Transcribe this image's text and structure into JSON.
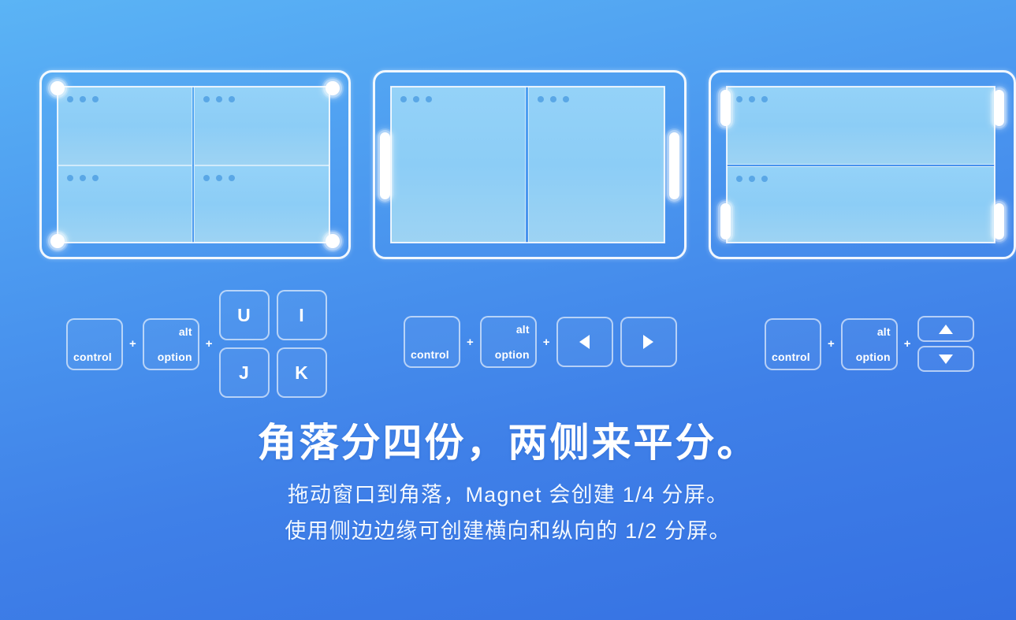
{
  "background": {
    "gradient_from": "#5bb4f5",
    "gradient_to": "#3570e2"
  },
  "panels": [
    {
      "name": "quarter-corners",
      "layout": "2x2",
      "handles": "four-corner-circles",
      "windows": [
        {
          "dots": 3
        },
        {
          "dots": 3
        },
        {
          "dots": 3
        },
        {
          "dots": 3
        }
      ]
    },
    {
      "name": "vertical-halves",
      "layout": "1x2-vertical",
      "handles": "left-right-edge-pills",
      "windows": [
        {
          "dots": 3
        },
        {
          "dots": 3
        }
      ]
    },
    {
      "name": "horizontal-halves",
      "layout": "2x1-horizontal",
      "handles": "four-side-pills",
      "windows": [
        {
          "dots": 3
        },
        {
          "dots": 3
        }
      ]
    }
  ],
  "shortcuts": [
    {
      "id": "corner-quarters",
      "modifiers": [
        {
          "top": "",
          "bottom": "control",
          "align": "left"
        },
        {
          "top": "alt",
          "bottom": "option",
          "align": "right"
        }
      ],
      "plus": "+",
      "keys": [
        "U",
        "I",
        "J",
        "K"
      ]
    },
    {
      "id": "left-right-halves",
      "modifiers": [
        {
          "top": "",
          "bottom": "control",
          "align": "left"
        },
        {
          "top": "alt",
          "bottom": "option",
          "align": "right"
        }
      ],
      "plus": "+",
      "keys": [
        "arrow-left",
        "arrow-right"
      ]
    },
    {
      "id": "top-bottom-halves",
      "modifiers": [
        {
          "top": "",
          "bottom": "control",
          "align": "left"
        },
        {
          "top": "alt",
          "bottom": "option",
          "align": "right"
        }
      ],
      "plus": "+",
      "keys": [
        "arrow-up",
        "arrow-down"
      ]
    }
  ],
  "caption": {
    "headline": "角落分四份，两侧来平分。",
    "subline_1": "拖动窗口到角落，Magnet 会创建 1/4 分屏。",
    "subline_2": "使用侧边边缘可创建横向和纵向的 1/2 分屏。"
  }
}
